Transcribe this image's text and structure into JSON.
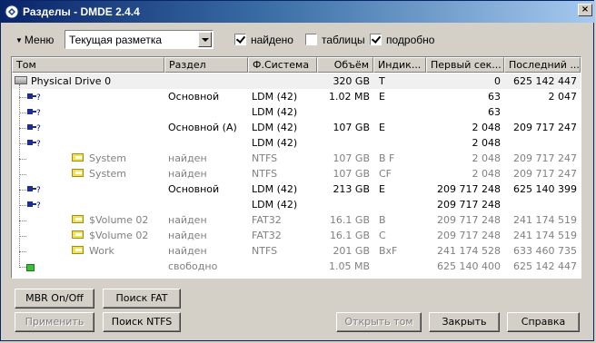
{
  "window": {
    "title": "Разделы - DMDE 2.4.4",
    "close_label": "×"
  },
  "toolbar": {
    "menu_label": "Меню",
    "view_select": {
      "value": "Текущая разметка"
    },
    "checkboxes": [
      {
        "label": "найдено",
        "checked": true
      },
      {
        "label": "таблицы",
        "checked": false
      },
      {
        "label": "подробно",
        "checked": true
      }
    ]
  },
  "table": {
    "columns": [
      "Том",
      "Раздел",
      "Ф.Система",
      "Объём",
      "Индик...",
      "Первый сек...",
      "Последний ..."
    ],
    "rows": [
      {
        "kind": "drive",
        "name": "Physical Drive 0",
        "part": "",
        "fs": "",
        "size": "320 GB",
        "ind": "T",
        "first": "0",
        "last": "625 142 447",
        "gray": false
      },
      {
        "kind": "volume",
        "name": "",
        "part": "Основной",
        "fs": "LDM (42)",
        "size": "1.02 MB",
        "ind": "E",
        "first": "63",
        "last": "2 047",
        "gray": false
      },
      {
        "kind": "volume",
        "name": "",
        "part": "",
        "fs": "LDM (42)",
        "size": "",
        "ind": "",
        "first": "63",
        "last": "",
        "gray": false
      },
      {
        "kind": "volume",
        "name": "",
        "part": "Основной (А)",
        "fs": "LDM (42)",
        "size": "107 GB",
        "ind": "E",
        "first": "2 048",
        "last": "209 717 247",
        "gray": false
      },
      {
        "kind": "volume",
        "name": "",
        "part": "",
        "fs": "LDM (42)",
        "size": "",
        "ind": "",
        "first": "2 048",
        "last": "",
        "gray": false
      },
      {
        "kind": "folder",
        "name": "System",
        "part": "найден",
        "fs": "NTFS",
        "size": "107 GB",
        "ind": "B  F",
        "first": "2 048",
        "last": "209 717 247",
        "gray": true
      },
      {
        "kind": "folder",
        "name": "System",
        "part": "найден",
        "fs": "NTFS",
        "size": "107 GB",
        "ind": "CF",
        "first": "2 048",
        "last": "209 717 247",
        "gray": true
      },
      {
        "kind": "volume",
        "name": "",
        "part": "Основной",
        "fs": "LDM (42)",
        "size": "213 GB",
        "ind": "E",
        "first": "209 717 248",
        "last": "625 140 399",
        "gray": false
      },
      {
        "kind": "volume",
        "name": "",
        "part": "",
        "fs": "LDM (42)",
        "size": "",
        "ind": "",
        "first": "209 717 248",
        "last": "",
        "gray": false
      },
      {
        "kind": "folder",
        "name": "$Volume 02",
        "part": "найден",
        "fs": "FAT32",
        "size": "16.1 GB",
        "ind": "B",
        "first": "209 717 248",
        "last": "241 174 519",
        "gray": true
      },
      {
        "kind": "folder",
        "name": "$Volume 02",
        "part": "найден",
        "fs": "FAT32",
        "size": "16.1 GB",
        "ind": "C",
        "first": "209 717 248",
        "last": "241 174 519",
        "gray": true
      },
      {
        "kind": "folder",
        "name": "Work",
        "part": "найден",
        "fs": "NTFS",
        "size": "201 GB",
        "ind": "BxF",
        "first": "241 174 528",
        "last": "633 460 735",
        "gray": true
      },
      {
        "kind": "free",
        "name": "",
        "part": "свободно",
        "fs": "",
        "size": "1.05 MB",
        "ind": "",
        "first": "625 140 400",
        "last": "625 142 447",
        "gray": true
      }
    ]
  },
  "buttons": {
    "mbr": "MBR On/Off",
    "search_fat": "Поиск FAT",
    "apply": "Применить",
    "search_ntfs": "Поиск NTFS",
    "open_volume": "Открыть том",
    "close": "Закрыть",
    "help": "Справка"
  }
}
